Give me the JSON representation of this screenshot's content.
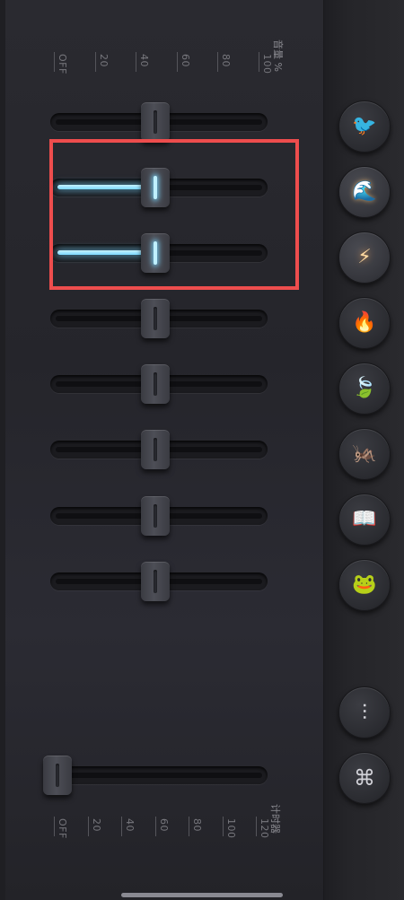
{
  "volume_scale": {
    "label": "音量 %",
    "ticks": [
      "OFF",
      "20",
      "40",
      "60",
      "80",
      "100"
    ]
  },
  "timer_scale": {
    "label": "计时器",
    "ticks": [
      "OFF",
      "20",
      "40",
      "60",
      "80",
      "100",
      "120"
    ]
  },
  "sliders": [
    {
      "name": "sound-1",
      "value_percent": 48,
      "active": false
    },
    {
      "name": "sound-2",
      "value_percent": 48,
      "active": true
    },
    {
      "name": "sound-3",
      "value_percent": 48,
      "active": true
    },
    {
      "name": "sound-4",
      "value_percent": 48,
      "active": false
    },
    {
      "name": "sound-5",
      "value_percent": 48,
      "active": false
    },
    {
      "name": "sound-6",
      "value_percent": 48,
      "active": false
    },
    {
      "name": "sound-7",
      "value_percent": 48,
      "active": false
    },
    {
      "name": "sound-8",
      "value_percent": 48,
      "active": false
    }
  ],
  "timer_slider": {
    "value_percent": 0
  },
  "sound_buttons": [
    {
      "icon": "bird-icon",
      "glyph": "🐦",
      "active": false
    },
    {
      "icon": "waves-icon",
      "glyph": "🌊",
      "active": true
    },
    {
      "icon": "lightning-icon",
      "glyph": "⚡",
      "active": true
    },
    {
      "icon": "campfire-icon",
      "glyph": "🔥",
      "active": false
    },
    {
      "icon": "leaf-icon",
      "glyph": "🍃",
      "active": false
    },
    {
      "icon": "cricket-icon",
      "glyph": "🦗",
      "active": false
    },
    {
      "icon": "book-icon",
      "glyph": "📖",
      "active": false
    },
    {
      "icon": "frog-icon",
      "glyph": "🐸",
      "active": false
    }
  ],
  "control_buttons": [
    {
      "icon": "equalizer-icon",
      "glyph": "⫶"
    },
    {
      "icon": "command-icon",
      "glyph": "⌘"
    }
  ],
  "colors": {
    "accent_glow": "#7ad8ff",
    "highlight_box": "#ee4d4d",
    "active_icon": "#ffd9a0"
  }
}
